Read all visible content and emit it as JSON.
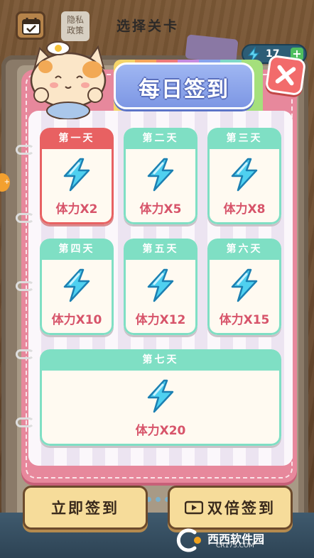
{
  "header": {
    "privacy_label": "隐私\n政策",
    "privacy_line1": "隐私",
    "privacy_line2": "政策",
    "title": "选择关卡",
    "energy_count": "17",
    "energy_plus": "+"
  },
  "modal": {
    "title": "每日签到",
    "days": [
      {
        "label": "第一天",
        "reward": "体力X2",
        "state": "today"
      },
      {
        "label": "第二天",
        "reward": "体力X5",
        "state": "locked"
      },
      {
        "label": "第三天",
        "reward": "体力X8",
        "state": "locked"
      },
      {
        "label": "第四天",
        "reward": "体力X10",
        "state": "locked"
      },
      {
        "label": "第五天",
        "reward": "体力X12",
        "state": "locked"
      },
      {
        "label": "第六天",
        "reward": "体力X15",
        "state": "locked"
      },
      {
        "label": "第七天",
        "reward": "体力X20",
        "state": "locked"
      }
    ]
  },
  "buttons": {
    "sign_in": "立即签到",
    "double_sign_in": "双倍签到"
  },
  "watermark": {
    "site": "西西软件园",
    "url": "CR173.COM"
  },
  "colors": {
    "modal_pink": "#e7889c",
    "today_red": "#e86162",
    "day_mint": "#7fdfc4",
    "reward_text": "#d7546a",
    "banner_blue": "#8aa5ec",
    "button_yellow": "#f6dc9a"
  },
  "icons": {
    "calendar": "calendar-check-icon",
    "close": "close-x-icon",
    "energy": "lightning-bolt-icon",
    "video": "video-play-icon"
  }
}
